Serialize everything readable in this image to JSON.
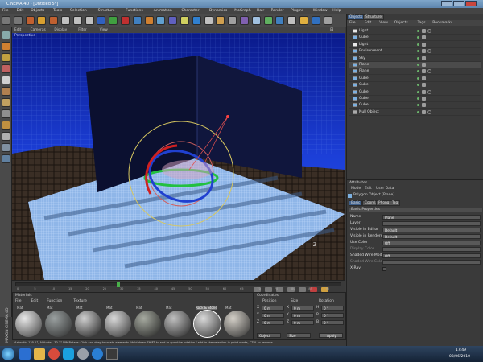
{
  "window": {
    "title": "CINEMA 4D - [Untitled 5*]"
  },
  "menu": [
    "File",
    "Edit",
    "Objects",
    "Tools",
    "Selection",
    "Structure",
    "Functions",
    "Animation",
    "Character",
    "Dynamics",
    "MoGraph",
    "Hair",
    "Render",
    "Plugins",
    "Window",
    "Help"
  ],
  "viewport": {
    "menu": [
      "Edit",
      "Cameras",
      "Display",
      "Filter",
      "View"
    ],
    "label": "Perspective",
    "hud": [
      "Z",
      "X",
      "Y"
    ]
  },
  "objects": {
    "tabs": [
      "Objects",
      "Structure"
    ],
    "menu": [
      "File",
      "Edit",
      "View",
      "Objects",
      "Tags",
      "Bookmarks"
    ],
    "items": [
      "Light",
      "Cube",
      "Light",
      "Environment",
      "Sky",
      "Plane",
      "Plane",
      "Cube",
      "Cube",
      "Cube",
      "Cube",
      "Cube",
      "Null Object"
    ]
  },
  "attributes": {
    "title": "Attributes",
    "menu": [
      "Mode",
      "Edit",
      "User Data"
    ],
    "object": "Polygon Object [Plane]",
    "tabs": [
      "Basic",
      "Coord.",
      "Phong",
      "Tag"
    ],
    "section": "Basic Properties",
    "fields": [
      {
        "label": "Name",
        "value": "Plane"
      },
      {
        "label": "Layer",
        "value": ""
      },
      {
        "label": "Visible in Editor",
        "value": "Default"
      },
      {
        "label": "Visible in Renderer",
        "value": "Default"
      },
      {
        "label": "Use Color",
        "value": "Off"
      },
      {
        "label": "Display Color",
        "value": ""
      },
      {
        "label": "Shaded Wire Mode",
        "value": "Off"
      },
      {
        "label": "Shaded Wire Color",
        "value": ""
      },
      {
        "label": "X-Ray",
        "value": ""
      }
    ]
  },
  "timeline": {
    "ticks": [
      "0",
      "5",
      "10",
      "15",
      "20",
      "25",
      "30",
      "35",
      "40",
      "45",
      "50",
      "55",
      "60",
      "65",
      "70",
      "75",
      "80",
      "85",
      "90"
    ],
    "frame": "0 F"
  },
  "materials": {
    "title": "Materials",
    "menu": [
      "File",
      "Edit",
      "Function",
      "Texture"
    ],
    "names": [
      "Mat",
      "Mat",
      "Mat",
      "Mat",
      "Mat",
      "Mat",
      "Rock & Stone",
      "Mat"
    ],
    "selected": "Rock & Stone"
  },
  "coordinates": {
    "title": "Coordinates",
    "headers": [
      "Position",
      "Size",
      "Rotation"
    ],
    "rows": [
      {
        "axis": "X",
        "pos": "0 m",
        "size": "0 m",
        "rot_label": "H",
        "rot": "0 °"
      },
      {
        "axis": "Y",
        "pos": "0 m",
        "size": "0 m",
        "rot_label": "P",
        "rot": "0 °"
      },
      {
        "axis": "Z",
        "pos": "0 m",
        "size": "0 m",
        "rot_label": "B",
        "rot": "0 °"
      }
    ],
    "mode_left": "Object",
    "mode_mid": "Size",
    "apply": "Apply"
  },
  "status": {
    "text": "Azimuth: 125.1°, Altitude: -30.3° NW  Rotate: Click and drag to rotate elements. Hold down SHIFT to add to quantize rotation / add to the selection in point mode, CTRL to remove."
  },
  "side_label": "MAXON CINEMA 4D",
  "taskbar": {
    "time": "17:49",
    "date": "03/06/2010"
  }
}
